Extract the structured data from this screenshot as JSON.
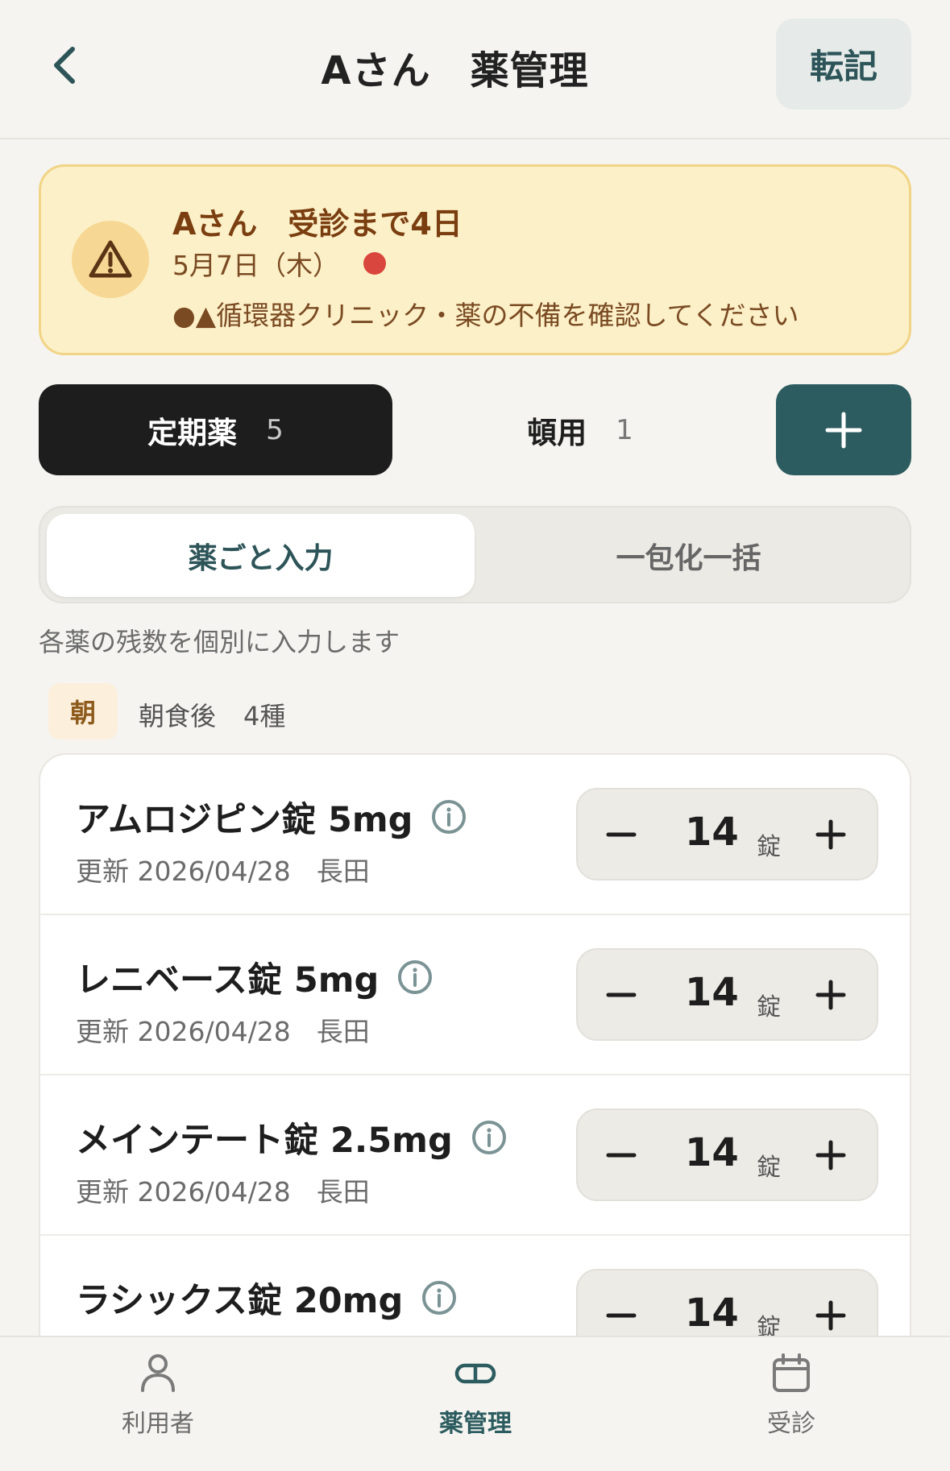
{
  "header": {
    "title": "Aさん　薬管理",
    "transcribe_label": "転記"
  },
  "alert": {
    "title": "Aさん　受診まで4日",
    "date": "5月7日（木）",
    "message": "●▲循環器クリニック・薬の不備を確認してください"
  },
  "categories": {
    "regular": {
      "label": "定期薬",
      "count": "5"
    },
    "prn": {
      "label": "頓用",
      "count": "1"
    }
  },
  "mode": {
    "per_drug": "薬ごと入力",
    "bulk": "一包化一括",
    "hint": "各薬の残数を個別に入力します"
  },
  "time_group": {
    "badge": "朝",
    "label": "朝食後",
    "count": "4種"
  },
  "medications": [
    {
      "name": "アムロジピン錠 5mg",
      "updated": "更新 2026/04/28",
      "by": "長田",
      "qty": "14",
      "unit": "錠"
    },
    {
      "name": "レニベース錠 5mg",
      "updated": "更新 2026/04/28",
      "by": "長田",
      "qty": "14",
      "unit": "錠"
    },
    {
      "name": "メインテート錠 2.5mg",
      "updated": "更新 2026/04/28",
      "by": "長田",
      "qty": "14",
      "unit": "錠"
    },
    {
      "name": "ラシックス錠 20mg",
      "updated": "",
      "by": "",
      "qty": "14",
      "unit": "錠"
    }
  ],
  "nav": {
    "users": "利用者",
    "meds": "薬管理",
    "visit": "受診"
  },
  "colors": {
    "accent": "#2d5c60",
    "alert_bg": "#fcf0c8",
    "alert_dot": "#d9463e"
  }
}
